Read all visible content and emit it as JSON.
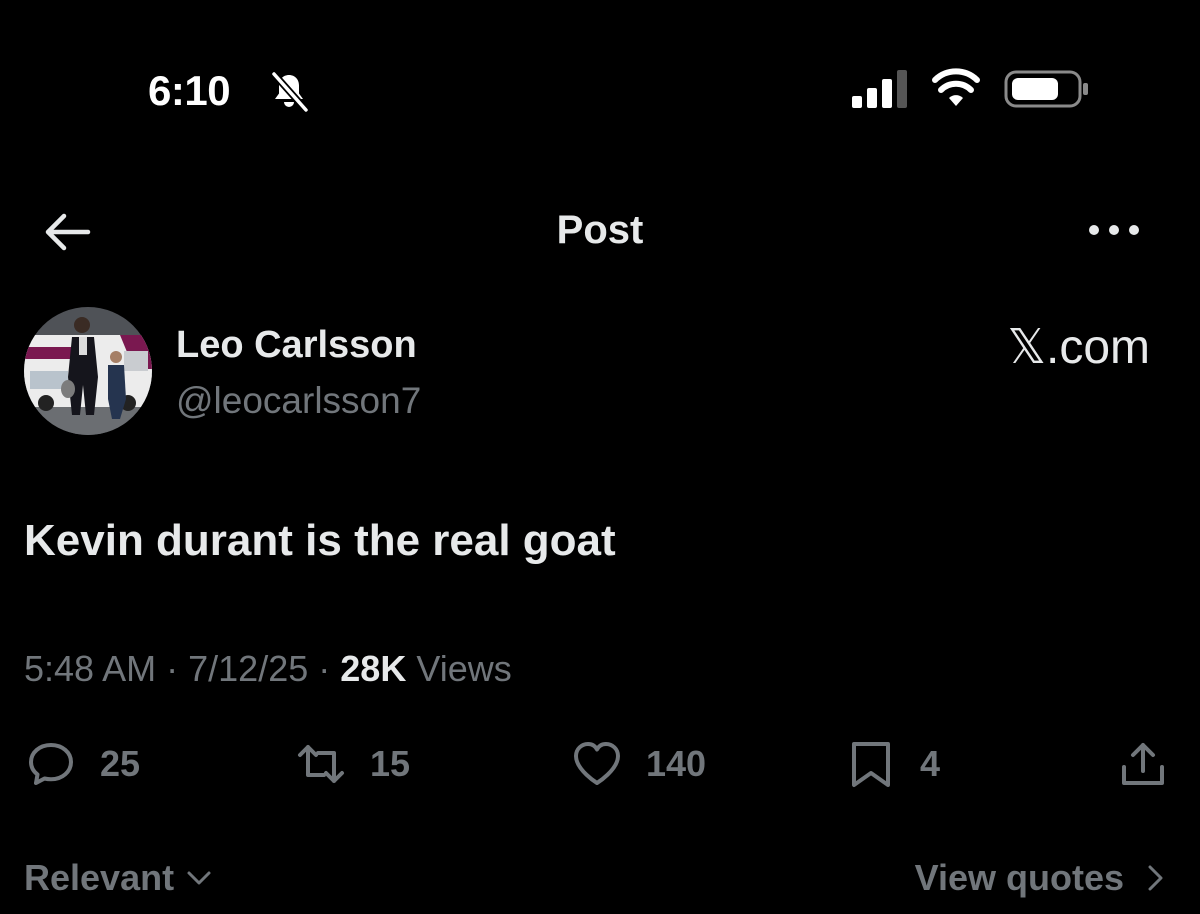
{
  "status_bar": {
    "time": "6:10",
    "bell_icon": "bell-slash-icon",
    "signal_icon": "cellular-signal-icon",
    "wifi_icon": "wifi-icon",
    "battery_icon": "battery-icon"
  },
  "nav": {
    "back_icon": "arrow-left-icon",
    "title": "Post",
    "more_icon": "more-horizontal-icon"
  },
  "author": {
    "name": "Leo Carlsson",
    "handle": "@leocarlsson7",
    "watermark": "𝕏.com"
  },
  "post": {
    "text": "Kevin durant is the real goat"
  },
  "meta": {
    "time": "5:48 AM",
    "sep1": "·",
    "date": "7/12/25",
    "sep2": "·",
    "views_count": "28K",
    "views_label": "Views"
  },
  "actions": {
    "replies": "25",
    "reposts": "15",
    "likes": "140",
    "bookmarks": "4"
  },
  "footer": {
    "sort_label": "Relevant",
    "view_quotes_label": "View quotes"
  },
  "colors": {
    "background": "#000000",
    "text_primary": "#e7e9ea",
    "text_secondary": "#71767b"
  }
}
